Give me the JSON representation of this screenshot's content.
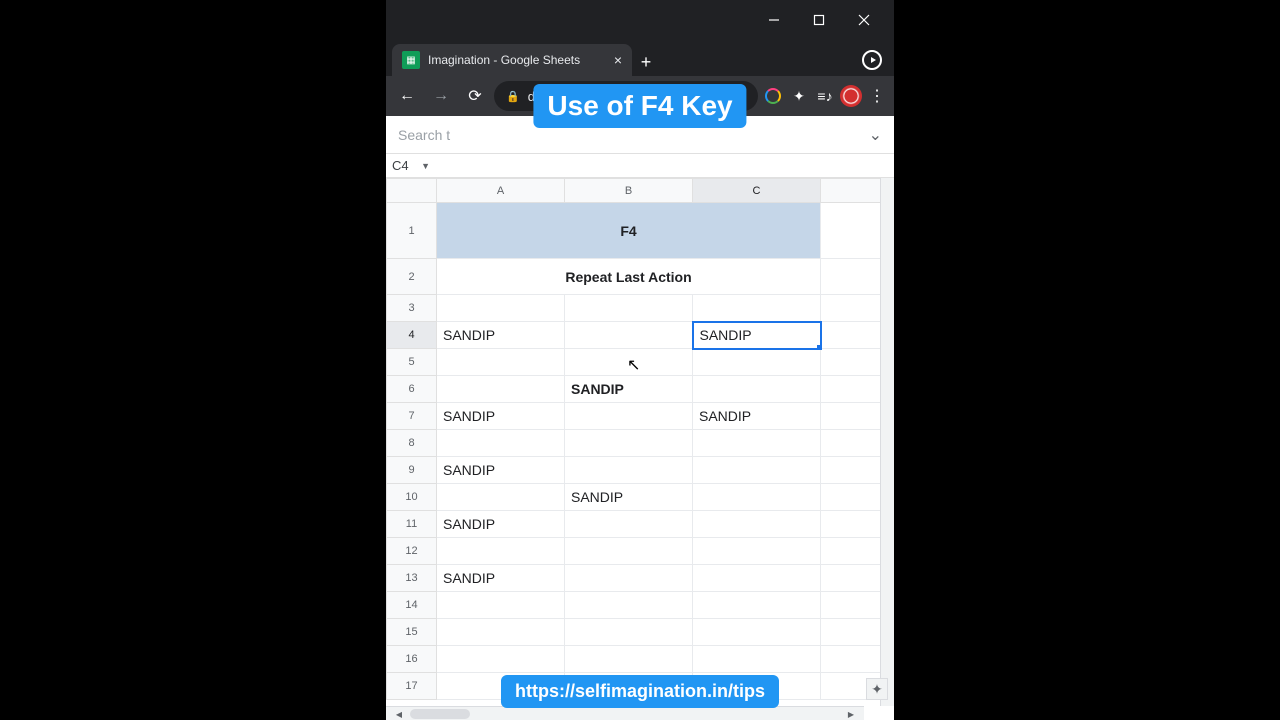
{
  "window": {
    "tab_title": "Imagination - Google Sheets"
  },
  "browser": {
    "url": "docs.google.com/spr…"
  },
  "sheets": {
    "search_placeholder": "Search t",
    "namebox": "C4",
    "columns": [
      "A",
      "B",
      "C"
    ],
    "merged_title": "F4",
    "merged_subtitle": "Repeat Last Action",
    "active_cell": "C4",
    "rows": [
      {
        "n": 3,
        "A": "",
        "B": "",
        "C": ""
      },
      {
        "n": 4,
        "A": "SANDIP",
        "B": "",
        "C": "SANDIP"
      },
      {
        "n": 5,
        "A": "",
        "B": "",
        "C": ""
      },
      {
        "n": 6,
        "A": "",
        "B": "SANDIP",
        "C": "",
        "B_bold": true
      },
      {
        "n": 7,
        "A": "SANDIP",
        "B": "",
        "C": "SANDIP"
      },
      {
        "n": 8,
        "A": "",
        "B": "",
        "C": ""
      },
      {
        "n": 9,
        "A": "SANDIP",
        "B": "",
        "C": ""
      },
      {
        "n": 10,
        "A": "",
        "B": "SANDIP",
        "C": ""
      },
      {
        "n": 11,
        "A": "SANDIP",
        "B": "",
        "C": ""
      },
      {
        "n": 12,
        "A": "",
        "B": "",
        "C": ""
      },
      {
        "n": 13,
        "A": "SANDIP",
        "B": "",
        "C": ""
      },
      {
        "n": 14,
        "A": "",
        "B": "",
        "C": ""
      },
      {
        "n": 15,
        "A": "",
        "B": "",
        "C": ""
      },
      {
        "n": 16,
        "A": "",
        "B": "",
        "C": ""
      },
      {
        "n": 17,
        "A": "",
        "B": "",
        "C": ""
      }
    ]
  },
  "overlays": {
    "title": "Use of F4 Key",
    "url": "https://selfimagination.in/tips"
  }
}
